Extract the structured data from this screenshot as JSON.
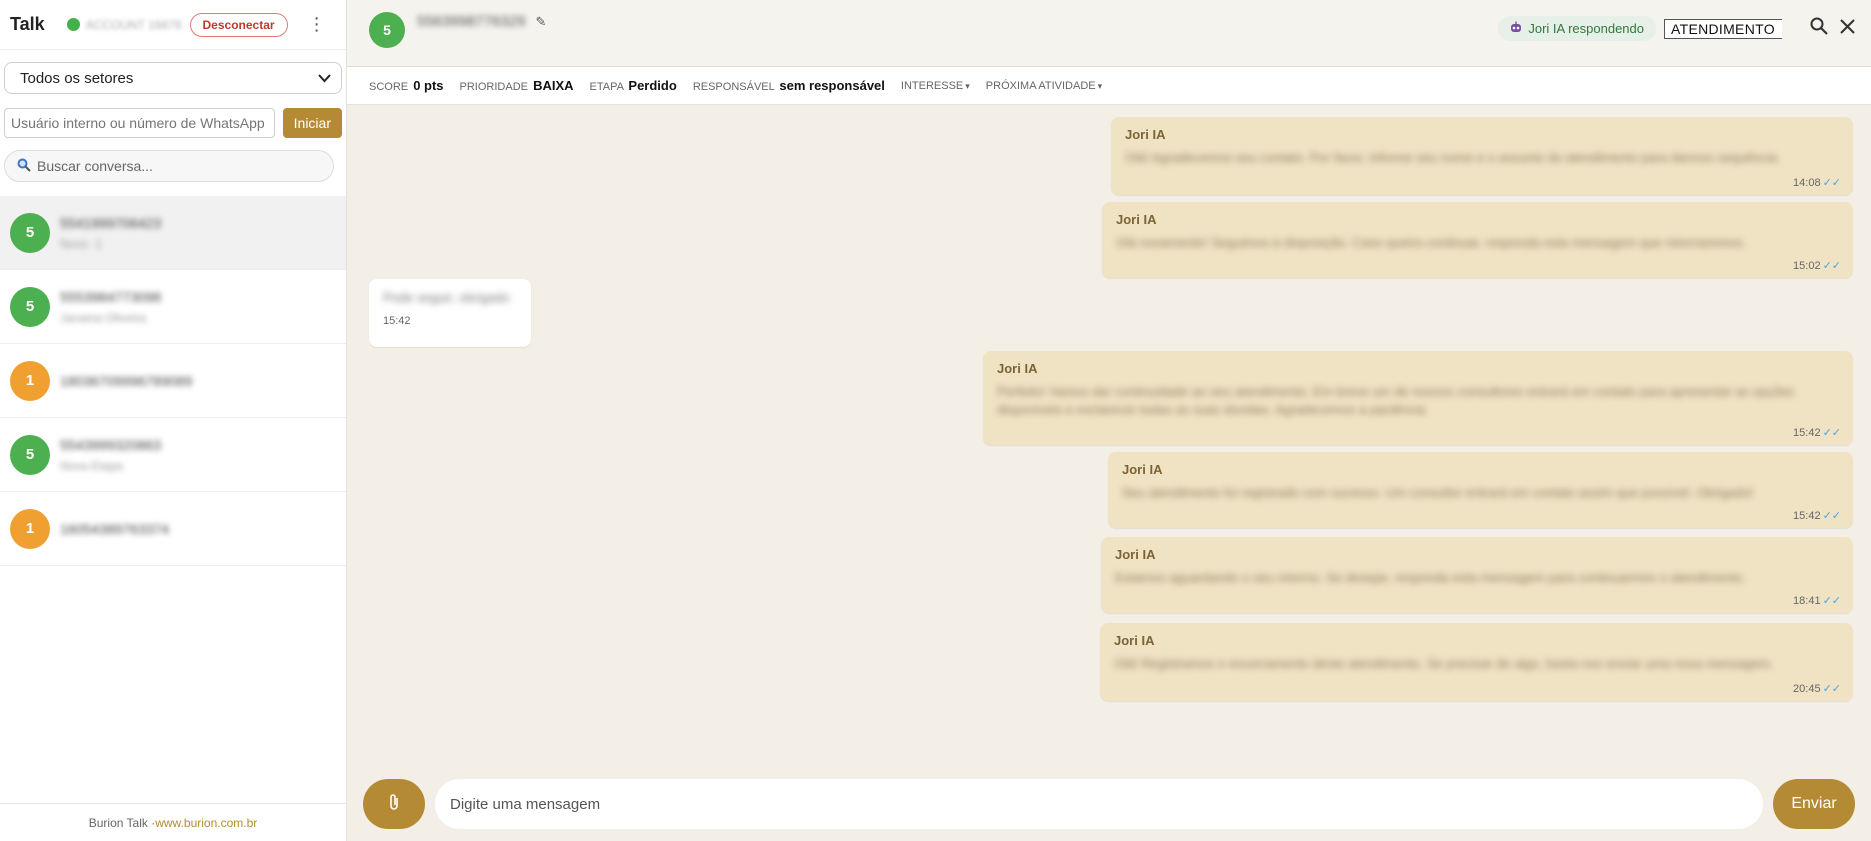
{
  "sidebar": {
    "app_title": "Talk",
    "account_label": "ACCOUNT 16878",
    "disconnect_label": "Desconectar",
    "menu_glyph": "⋮",
    "sector_select": "Todos os setores",
    "start_input_placeholder": "Usuário interno ou número de WhatsApp",
    "start_button": "Iniciar",
    "search_placeholder": "Buscar conversa...",
    "conversations": [
      {
        "badge": "5",
        "color": "green",
        "name": "5541999706423",
        "sub": "Novo ·1",
        "active": true
      },
      {
        "badge": "5",
        "color": "green",
        "name": "5553984773098",
        "sub": "Janaina Oliveira",
        "active": false
      },
      {
        "badge": "1",
        "color": "orange",
        "name": "18036709996789089",
        "sub": "",
        "active": false
      },
      {
        "badge": "5",
        "color": "green",
        "name": "5543999320863",
        "sub": "Nova Etapa",
        "active": false
      },
      {
        "badge": "1",
        "color": "orange",
        "name": "16054389763374",
        "sub": "",
        "active": false
      }
    ],
    "footer_text": "Burion Talk · ",
    "footer_link": "www.burion.com.br"
  },
  "chat": {
    "contact_badge": "5",
    "contact_name": "5563998776329",
    "ai_status": "Jori IA respondendo",
    "mode_field": "ATENDIMENTO",
    "meta": {
      "score_label": "SCORE",
      "score_value": "0 pts",
      "priority_label": "PRIORIDADE",
      "priority_value": "BAIXA",
      "stage_label": "ETAPA",
      "stage_value": "Perdido",
      "owner_label": "RESPONSÁVEL",
      "owner_value": "sem responsável",
      "interest_label": "INTERESSE",
      "next_label": "PRÓXIMA ATIVIDADE"
    },
    "messages": [
      {
        "author": "Jori IA",
        "body": "Olá! Agradecemos seu contato. Por favor, informe seu nome e o assunto do atendimento para darmos sequência.",
        "time": "14:08"
      },
      {
        "author": "Jori IA",
        "body": "Olá novamente! Seguimos à disposição. Caso queira continuar, responda esta mensagem que retornaremos.",
        "time": "15:02"
      },
      {
        "author": "",
        "body": "Pode seguir, obrigado",
        "time": "15:42"
      },
      {
        "author": "Jori IA",
        "body": "Perfeito! Vamos dar continuidade ao seu atendimento. Em breve um de nossos consultores entrará em contato para apresentar as opções disponíveis e esclarecer todas as suas dúvidas. Agradecemos a paciência.",
        "time": "15:42"
      },
      {
        "author": "Jori IA",
        "body": "Seu atendimento foi registrado com sucesso. Um consultor entrará em contato assim que possível. Obrigado!",
        "time": "15:42"
      },
      {
        "author": "Jori IA",
        "body": "Estamos aguardando o seu retorno. Se desejar, responda esta mensagem para continuarmos o atendimento.",
        "time": "18:41"
      },
      {
        "author": "Jori IA",
        "body": "Olá! Registramos o encerramento deste atendimento. Se precisar de algo, basta nos enviar uma nova mensagem.",
        "time": "20:45"
      }
    ],
    "composer_placeholder": "Digite uma mensagem",
    "send_label": "Enviar"
  }
}
